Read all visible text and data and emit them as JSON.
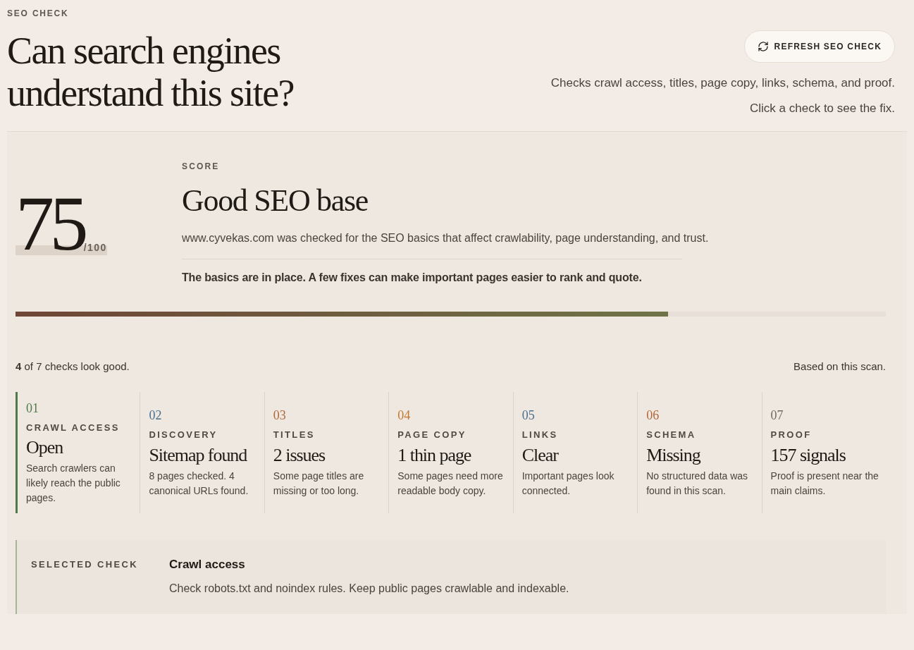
{
  "header": {
    "eyebrow": "SEO CHECK",
    "title_lines": [
      "Can search engines",
      "understand this site?"
    ],
    "refresh_button": "REFRESH SEO CHECK",
    "notes": [
      "Checks crawl access, titles, page copy, links, schema, and proof.",
      "Click a check to see the fix."
    ]
  },
  "score": {
    "value": "75",
    "out_of": "/100",
    "eyebrow": "SCORE",
    "headline": "Good SEO base",
    "description": "www.cyvekas.com was checked for the SEO basics that affect crawlability, page understanding, and trust.",
    "verdict": "The basics are in place. A few fixes can make important pages easier to rank and quote.",
    "level": 0.75
  },
  "summary": {
    "count_text": "**4** of 7 checks look good.",
    "basis": "Based on this scan."
  },
  "checks": [
    {
      "number": "01",
      "color": "#4f7a4a",
      "label": "CRAWL ACCESS",
      "result": "Open",
      "detail": "Search crawlers can likely reach the public pages.",
      "selected": true
    },
    {
      "number": "02",
      "color": "#4a6f8f",
      "label": "DISCOVERY",
      "result": "Sitemap found",
      "detail": "8 pages checked. 4 canonical URLs found.",
      "selected": false
    },
    {
      "number": "03",
      "color": "#b0683a",
      "label": "TITLES",
      "result": "2 issues",
      "detail": "Some page titles are missing or too long.",
      "selected": false
    },
    {
      "number": "04",
      "color": "#c07a34",
      "label": "PAGE COPY",
      "result": "1 thin page",
      "detail": "Some pages need more readable body copy.",
      "selected": false
    },
    {
      "number": "05",
      "color": "#4a6f8f",
      "label": "LINKS",
      "result": "Clear",
      "detail": "Important pages look connected.",
      "selected": false
    },
    {
      "number": "06",
      "color": "#b0683a",
      "label": "SCHEMA",
      "result": "Missing",
      "detail": "No structured data was found in this scan.",
      "selected": false
    },
    {
      "number": "07",
      "color": "#6f6a60",
      "label": "PROOF",
      "result": "157 signals",
      "detail": "Proof is present near the main claims.",
      "selected": false
    }
  ],
  "selected_check": {
    "eyebrow": "SELECTED CHECK",
    "title": "Crawl access",
    "fix": "Check robots.txt and noindex rules. Keep public pages crawlable and indexable."
  }
}
